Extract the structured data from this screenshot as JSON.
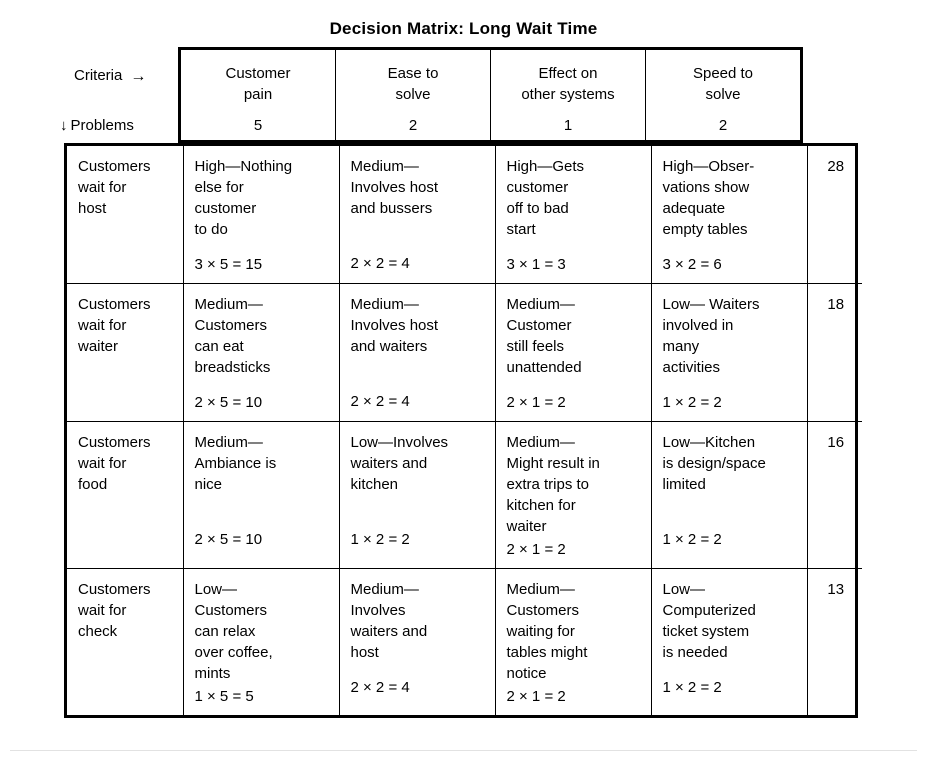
{
  "title": "Decision Matrix: Long Wait Time",
  "axis": {
    "criteria_label": "Criteria",
    "criteria_arrow": "→",
    "problems_label": "Problems",
    "problems_arrow": "↓"
  },
  "colors": {
    "border": "#000000",
    "text": "#000000",
    "background": "#ffffff",
    "hairline": "#e2e2e2"
  },
  "criteria": [
    {
      "name": "Customer\npain",
      "weight": "5"
    },
    {
      "name": "Ease to\nsolve",
      "weight": "2"
    },
    {
      "name": "Effect on\nother systems",
      "weight": "1"
    },
    {
      "name": "Speed to\nsolve",
      "weight": "2"
    }
  ],
  "rows": [
    {
      "problem": "Customers\nwait for\nhost",
      "cells": [
        {
          "text": "High—Nothing\nelse for\ncustomer\nto do",
          "score": "3 × 5 = 15"
        },
        {
          "text": "Medium—\nInvolves host\nand bussers",
          "score": "2 × 2 = 4"
        },
        {
          "text": "High—Gets\ncustomer\noff to bad\nstart",
          "score": "3 × 1 = 3"
        },
        {
          "text": "High—Obser-\nvations show\nadequate\nempty tables",
          "score": "3 × 2 = 6"
        }
      ],
      "total": "28"
    },
    {
      "problem": "Customers\nwait for\nwaiter",
      "cells": [
        {
          "text": "Medium—\nCustomers\ncan eat\nbreadsticks",
          "score": "2 × 5 = 10"
        },
        {
          "text": "Medium—\nInvolves host\nand waiters",
          "score": "2 × 2 = 4"
        },
        {
          "text": "Medium—\nCustomer\nstill feels\nunattended",
          "score": "2 × 1 = 2"
        },
        {
          "text": "Low— Waiters\ninvolved in\nmany\nactivities",
          "score": "1 × 2 = 2"
        }
      ],
      "total": "18"
    },
    {
      "problem": "Customers\nwait for\nfood",
      "cells": [
        {
          "text": "Medium—\nAmbiance is\nnice",
          "score": "2 × 5 = 10"
        },
        {
          "text": "Low—Involves\nwaiters and\nkitchen",
          "score": "1 × 2 = 2"
        },
        {
          "text": "Medium—\nMight result in\nextra trips to\nkitchen for\nwaiter",
          "score": "2 × 1 = 2"
        },
        {
          "text": "Low—Kitchen\nis design/space\nlimited",
          "score": "1 × 2 = 2"
        }
      ],
      "total": "16"
    },
    {
      "problem": "Customers\nwait for\ncheck",
      "cells": [
        {
          "text": "Low—\nCustomers\ncan relax\nover coffee,\nmints",
          "score": "1 × 5 = 5"
        },
        {
          "text": "Medium—\nInvolves\nwaiters and\nhost",
          "score": "2 × 2 = 4"
        },
        {
          "text": "Medium—\nCustomers\nwaiting for\ntables might\nnotice",
          "score": "2 × 1 = 2"
        },
        {
          "text": "Low—\nComputerized\nticket system\nis needed",
          "score": "1 × 2 = 2"
        }
      ],
      "total": "13"
    }
  ]
}
